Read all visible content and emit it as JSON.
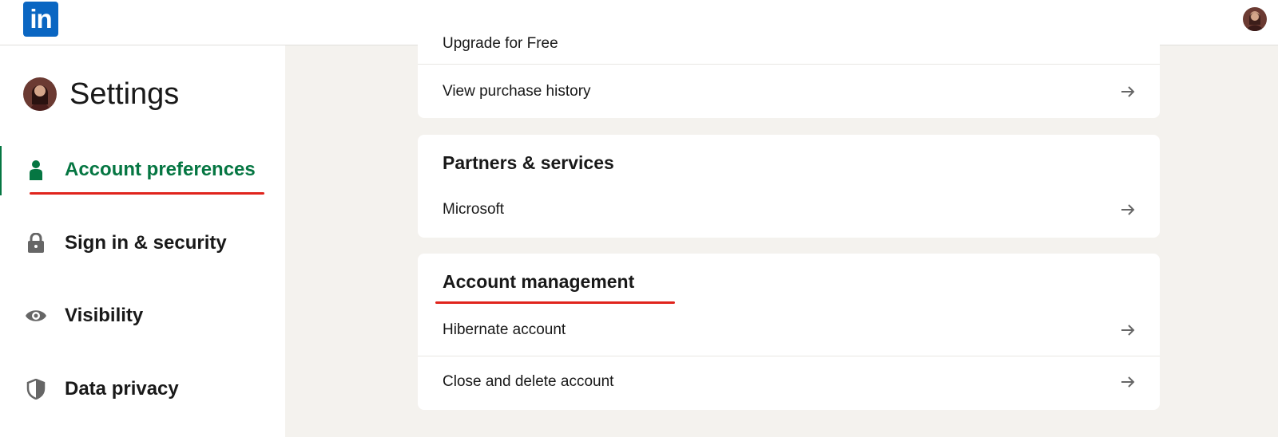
{
  "topbar": {
    "logo_text": "in"
  },
  "sidebar": {
    "title": "Settings",
    "items": [
      {
        "label": "Account preferences",
        "icon": "person-icon",
        "active": true
      },
      {
        "label": "Sign in & security",
        "icon": "lock-icon",
        "active": false
      },
      {
        "label": "Visibility",
        "icon": "eye-icon",
        "active": false
      },
      {
        "label": "Data privacy",
        "icon": "shield-icon",
        "active": false
      }
    ]
  },
  "main": {
    "card1": {
      "partial_label": "Upgrade for Free",
      "rows": [
        {
          "label": "View purchase history"
        }
      ]
    },
    "card2": {
      "title": "Partners & services",
      "rows": [
        {
          "label": "Microsoft"
        }
      ]
    },
    "card3": {
      "title": "Account management",
      "rows": [
        {
          "label": "Hibernate account"
        },
        {
          "label": "Close and delete account"
        }
      ]
    }
  },
  "colors": {
    "brand": "#0a66c2",
    "active": "#057642",
    "annotation": "#e0241c",
    "background": "#f4f2ee"
  }
}
